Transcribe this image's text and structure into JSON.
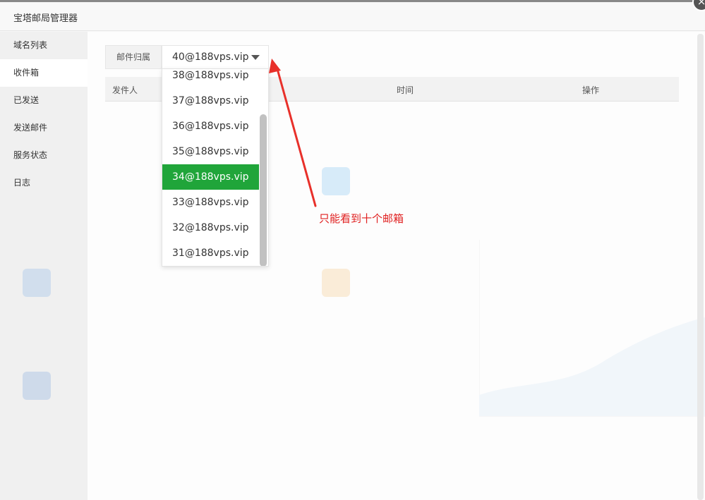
{
  "window": {
    "title": "宝塔邮局管理器",
    "close_symbol": "×"
  },
  "sidebar": {
    "items": [
      {
        "label": "域名列表"
      },
      {
        "label": "收件箱"
      },
      {
        "label": "已发送"
      },
      {
        "label": "发送邮件"
      },
      {
        "label": "服务状态"
      },
      {
        "label": "日志"
      }
    ]
  },
  "filter": {
    "label": "邮件归属",
    "selected_value": "40@188vps.vip"
  },
  "table": {
    "headers": [
      "发件人",
      "时间",
      "操作"
    ]
  },
  "dropdown": {
    "options": [
      "38@188vps.vip",
      "37@188vps.vip",
      "36@188vps.vip",
      "35@188vps.vip",
      "34@188vps.vip",
      "33@188vps.vip",
      "32@188vps.vip",
      "31@188vps.vip"
    ],
    "highlighted": "34@188vps.vip",
    "highlight_color": "#20a53a"
  },
  "annotation": {
    "text": "只能看到十个邮箱",
    "color": "#e02020"
  }
}
